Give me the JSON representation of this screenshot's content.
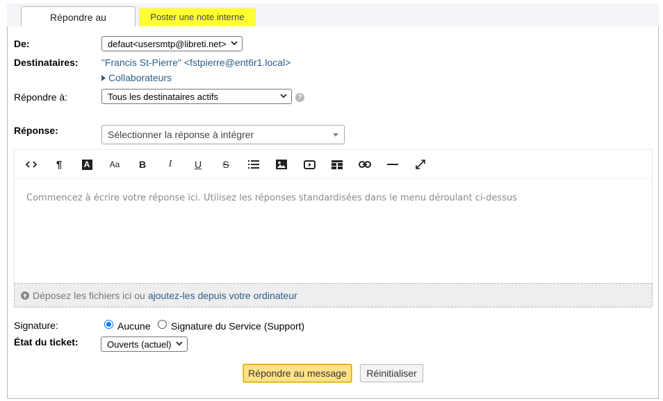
{
  "tabs": [
    {
      "label": "Répondre au message"
    },
    {
      "label": "Poster une note interne"
    }
  ],
  "form": {
    "from_label": "De:",
    "from_value": "defaut<usersmtp@libreti.net>",
    "recipients_label": "Destinataires:",
    "recipients_value": "\"Francis St-Pierre\" <fstpierre@ent6r1.local>",
    "collaborators_label": "Collaborateurs",
    "reply_to_label": "Répondre à:",
    "reply_to_value": "Tous les destinataires actifs",
    "response_label": "Réponse:",
    "response_placeholder": "Sélectionner la réponse à intégrer",
    "editor_placeholder": "Commencez à écrire votre réponse ici. Utilisez les réponses standardisées dans le menu déroulant ci-dessus",
    "dropzone_text": "Déposez les fichiers ici ou ",
    "dropzone_link": "ajoutez-les depuis votre ordinateur",
    "signature_label": "Signature:",
    "signature_options": [
      "Aucune",
      "Signature du Service (Support)"
    ],
    "signature_selected": "Aucune",
    "ticket_status_label": "État du ticket:",
    "ticket_status_value": "Ouverts (actuel)"
  },
  "toolbar": {
    "icons": [
      "code-view-icon",
      "paragraph-icon",
      "text-color-icon",
      "font-size-icon",
      "bold-icon",
      "italic-icon",
      "underline-icon",
      "strikethrough-icon",
      "list-icon",
      "image-icon",
      "video-icon",
      "table-icon",
      "link-icon",
      "horizontal-rule-icon",
      "fullscreen-icon"
    ],
    "glyphs": {
      "font_size": "Aa",
      "bold": "B",
      "italic": "I",
      "underline": "U",
      "strike": "S",
      "paragraph": "¶",
      "text_color": "A",
      "code": "<>"
    }
  },
  "buttons": {
    "submit": "Répondre au message",
    "reset": "Réinitialiser"
  },
  "colors": {
    "internal_tab": "#ffff33",
    "primary_button": "#ffe287",
    "link": "#2a5d8a"
  }
}
